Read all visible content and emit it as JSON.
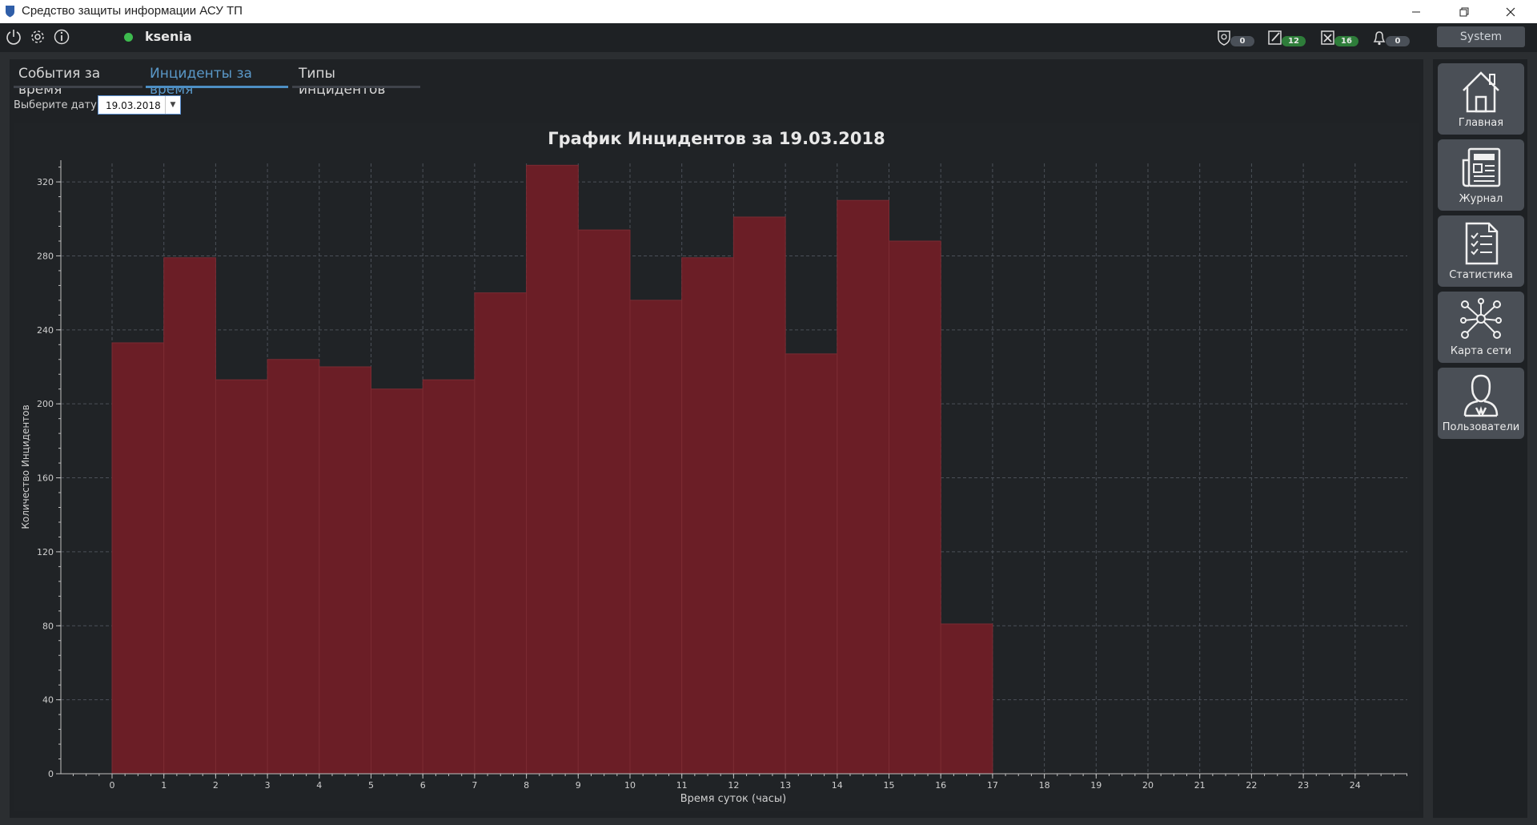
{
  "window": {
    "title": "Средство защиты информации АСУ ТП",
    "controls": [
      "minimize",
      "restore",
      "close"
    ]
  },
  "topbar": {
    "icons": [
      "power-icon",
      "gear-icon",
      "info-icon"
    ],
    "user": {
      "name": "ksenia",
      "status_color": "#3dbb4e"
    },
    "indicators": [
      {
        "icon": "shield-icon",
        "count": "0",
        "badge_color": "#4a5058"
      },
      {
        "icon": "edit-icon",
        "count": "12",
        "badge_color": "#2e7d3a"
      },
      {
        "icon": "tools-icon",
        "count": "16",
        "badge_color": "#2e7d3a"
      },
      {
        "icon": "bell-icon",
        "count": "0",
        "badge_color": "#4a5058"
      }
    ],
    "system_button": "System"
  },
  "tabs": [
    {
      "label": "События за время",
      "active": false
    },
    {
      "label": "Инциденты за время",
      "active": true
    },
    {
      "label": "Типы инцидентов",
      "active": false
    }
  ],
  "date_picker": {
    "label": "Выберите дату:",
    "value": "19.03.2018"
  },
  "chart_data": {
    "type": "bar",
    "title": "График Инцидентов за 19.03.2018",
    "xlabel": "Время суток (часы)",
    "ylabel": "Количество Инцидентов",
    "x_ticks": [
      "0",
      "1",
      "2",
      "3",
      "4",
      "5",
      "6",
      "7",
      "8",
      "9",
      "10",
      "11",
      "12",
      "13",
      "14",
      "15",
      "16",
      "17",
      "18",
      "19",
      "20",
      "21",
      "22",
      "23",
      "24"
    ],
    "categories": [
      "0",
      "1",
      "2",
      "3",
      "4",
      "5",
      "6",
      "7",
      "8",
      "9",
      "10",
      "11",
      "12",
      "13",
      "14",
      "15",
      "16"
    ],
    "values": [
      233,
      279,
      213,
      224,
      220,
      208,
      213,
      260,
      329,
      294,
      256,
      279,
      301,
      227,
      310,
      288,
      81
    ],
    "ylim": [
      0,
      330
    ],
    "y_ticks": [
      "0",
      "40",
      "80",
      "120",
      "160",
      "200",
      "240",
      "280",
      "320"
    ],
    "grid": true,
    "bar_color": "#6b1e26"
  },
  "sidebar": {
    "items": [
      {
        "label": "Главная",
        "icon": "home-icon"
      },
      {
        "label": "Журнал",
        "icon": "journal-icon"
      },
      {
        "label": "Статистика",
        "icon": "statistics-icon"
      },
      {
        "label": "Карта сети",
        "icon": "network-map-icon"
      },
      {
        "label": "Пользователи",
        "icon": "users-icon"
      }
    ]
  }
}
